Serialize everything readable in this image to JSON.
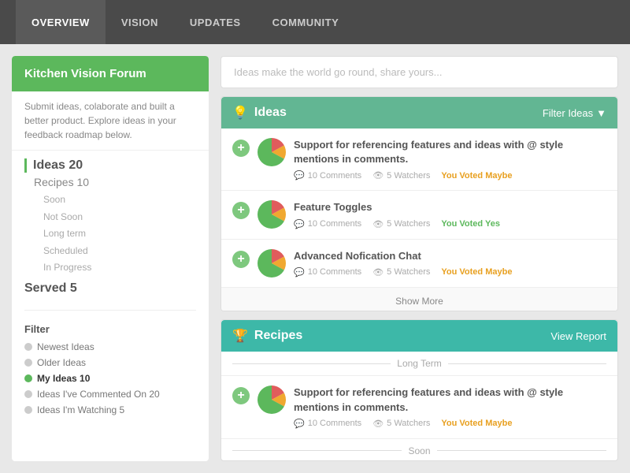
{
  "nav": {
    "items": [
      {
        "label": "OVERVIEW",
        "active": true
      },
      {
        "label": "VISION",
        "active": false
      },
      {
        "label": "UPDATES",
        "active": false
      },
      {
        "label": "COMMUNITY",
        "active": false
      }
    ]
  },
  "sidebar": {
    "title": "Kitchen Vision Forum",
    "description": "Submit ideas, colaborate and built a better product. Explore ideas in your feedback roadmap below.",
    "stats": {
      "ideas_label": "Ideas 20",
      "recipes_label": "Recipes 10",
      "soon": "Soon",
      "not_soon": "Not Soon",
      "long_term": "Long term",
      "scheduled": "Scheduled",
      "in_progress": "In Progress",
      "served_label": "Served 5"
    },
    "filter": {
      "title": "Filter",
      "items": [
        {
          "label": "Newest Ideas",
          "active": false,
          "dot": "grey",
          "count": ""
        },
        {
          "label": "Older Ideas",
          "active": false,
          "dot": "grey",
          "count": ""
        },
        {
          "label": "My Ideas 10",
          "active": true,
          "dot": "green",
          "count": ""
        },
        {
          "label": "Ideas I've Commented On 20",
          "active": false,
          "dot": "grey",
          "count": ""
        },
        {
          "label": "Ideas I'm Watching 5",
          "active": false,
          "dot": "grey",
          "count": ""
        }
      ]
    }
  },
  "search": {
    "placeholder": "Ideas make the world go round, share yours..."
  },
  "ideas_section": {
    "title": "Ideas",
    "filter_label": "Filter Ideas",
    "cards": [
      {
        "title": "Support for referencing features and ideas with @ style mentions in comments.",
        "comments": "10 Comments",
        "watchers": "5 Watchers",
        "voted": "You Voted Maybe",
        "voted_class": "maybe"
      },
      {
        "title": "Feature Toggles",
        "comments": "10 Comments",
        "watchers": "5 Watchers",
        "voted": "You Voted Yes",
        "voted_class": "yes"
      },
      {
        "title": "Advanced Nofication Chat",
        "comments": "10 Comments",
        "watchers": "5 Watchers",
        "voted": "You Voted Maybe",
        "voted_class": "maybe"
      }
    ],
    "show_more": "Show More"
  },
  "recipes_section": {
    "title": "Recipes",
    "action_label": "View Report",
    "long_term_label": "Long Term",
    "cards": [
      {
        "title": "Support for referencing features and ideas with @ style mentions in comments.",
        "comments": "10 Comments",
        "watchers": "5 Watchers",
        "voted": "You Voted Maybe",
        "voted_class": "maybe"
      }
    ],
    "soon_label": "Soon"
  },
  "icons": {
    "bulb": "💡",
    "trophy": "🏆",
    "comment": "💬",
    "eye": "👁",
    "chevron_down": "▼"
  }
}
